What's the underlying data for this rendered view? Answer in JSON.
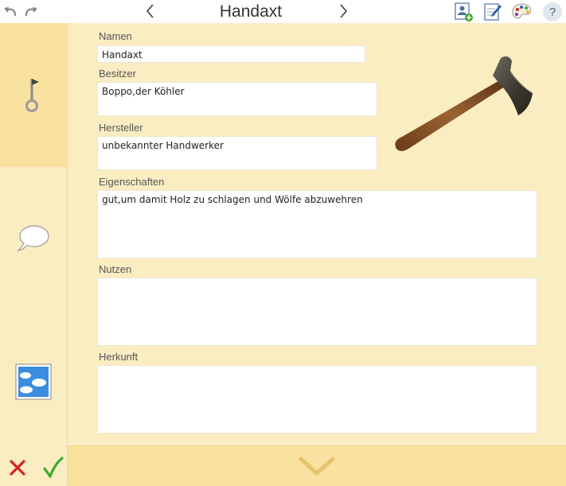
{
  "header": {
    "title": "Handaxt"
  },
  "icons": {
    "undo": "undo-icon",
    "redo": "redo-icon",
    "prev": "chevron-left-icon",
    "next": "chevron-right-icon",
    "add_person": "add-person-icon",
    "edit": "edit-note-icon",
    "palette": "palette-icon",
    "help": "help-icon",
    "cancel": "close-icon",
    "confirm": "check-icon",
    "expand": "chevron-down-icon"
  },
  "sidebar": {
    "tabs": [
      {
        "name": "key",
        "active": true
      },
      {
        "name": "speech",
        "active": false
      },
      {
        "name": "image",
        "active": false
      }
    ]
  },
  "help_label": "?",
  "fields": {
    "namen": {
      "label": "Namen",
      "value": "Handaxt"
    },
    "besitzer": {
      "label": "Besitzer",
      "value": "Boppo,der Köhler"
    },
    "hersteller": {
      "label": "Hersteller",
      "value": "unbekannter Handwerker"
    },
    "eigenschaften": {
      "label": "Eigenschaften",
      "value": "gut,um damit Holz zu schlagen und Wölfe abzuwehren"
    },
    "nutzen": {
      "label": "Nutzen",
      "value": ""
    },
    "herkunft": {
      "label": "Herkunft",
      "value": ""
    }
  },
  "colors": {
    "background": "#fbedc2",
    "active_tab": "#f9e1a0",
    "cancel": "#d62020",
    "confirm": "#3caa2a"
  }
}
